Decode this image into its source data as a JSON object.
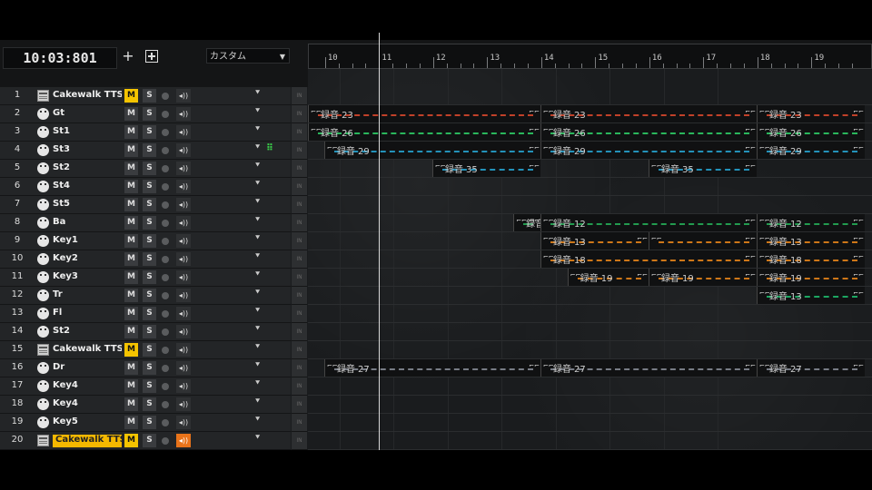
{
  "clock": "10:03:801",
  "preset": "カスタム",
  "ruler": [
    "10",
    "11",
    "12",
    "13",
    "14",
    "15",
    "16",
    "17",
    "18",
    "19"
  ],
  "buttons": {
    "mute": "M",
    "solo": "S",
    "add": "+"
  },
  "icons": {
    "add": "plus-icon",
    "add_track": "add-track-icon",
    "expand": "chevron-down-icon",
    "monitor": "speaker-icon",
    "record": "record-arm-icon"
  },
  "colors": {
    "mute_on": "#f5c400",
    "monitor_on": "#e8731a",
    "gt": "#e04a2e",
    "st1": "#2fd46a",
    "st3": "#27a9d8",
    "ba": "#27b45a",
    "key": "#f0891a",
    "tr": "#20c070",
    "dr": "#8a8f9a"
  },
  "tracks": [
    {
      "num": "1",
      "name": "Cakewalk TTS-",
      "type": "audio",
      "mute": true,
      "highlight": false,
      "monitor": false
    },
    {
      "num": "2",
      "name": "Gt",
      "type": "midi",
      "mute": false,
      "highlight": false,
      "monitor": false
    },
    {
      "num": "3",
      "name": "St1",
      "type": "midi",
      "mute": false,
      "highlight": false,
      "monitor": false
    },
    {
      "num": "4",
      "name": "St3",
      "type": "midi",
      "mute": false,
      "highlight": false,
      "monitor": false,
      "extra": "⠿"
    },
    {
      "num": "5",
      "name": "St2",
      "type": "midi",
      "mute": false,
      "highlight": false,
      "monitor": false
    },
    {
      "num": "6",
      "name": "St4",
      "type": "midi",
      "mute": false,
      "highlight": false,
      "monitor": false
    },
    {
      "num": "7",
      "name": "St5",
      "type": "midi",
      "mute": false,
      "highlight": false,
      "monitor": false
    },
    {
      "num": "8",
      "name": "Ba",
      "type": "midi",
      "mute": false,
      "highlight": false,
      "monitor": false
    },
    {
      "num": "9",
      "name": "Key1",
      "type": "midi",
      "mute": false,
      "highlight": false,
      "monitor": false
    },
    {
      "num": "10",
      "name": "Key2",
      "type": "midi",
      "mute": false,
      "highlight": false,
      "monitor": false
    },
    {
      "num": "11",
      "name": "Key3",
      "type": "midi",
      "mute": false,
      "highlight": false,
      "monitor": false
    },
    {
      "num": "12",
      "name": "Tr",
      "type": "midi",
      "mute": false,
      "highlight": false,
      "monitor": false
    },
    {
      "num": "13",
      "name": "Fl",
      "type": "midi",
      "mute": false,
      "highlight": false,
      "monitor": false
    },
    {
      "num": "14",
      "name": "St2",
      "type": "midi",
      "mute": false,
      "highlight": false,
      "monitor": false
    },
    {
      "num": "15",
      "name": "Cakewalk TTS-",
      "type": "audio",
      "mute": true,
      "highlight": false,
      "monitor": false
    },
    {
      "num": "16",
      "name": "Dr",
      "type": "midi",
      "mute": false,
      "highlight": false,
      "monitor": false
    },
    {
      "num": "17",
      "name": "Key4",
      "type": "midi",
      "mute": false,
      "highlight": false,
      "monitor": false
    },
    {
      "num": "18",
      "name": "Key4",
      "type": "midi",
      "mute": false,
      "highlight": false,
      "monitor": false
    },
    {
      "num": "19",
      "name": "Key5",
      "type": "midi",
      "mute": false,
      "highlight": false,
      "monitor": false
    },
    {
      "num": "20",
      "name": "Cakewalk TTS-",
      "type": "audio",
      "mute": true,
      "highlight": true,
      "monitor": true
    }
  ],
  "clips": [
    {
      "track": 2,
      "start": 9.6,
      "end": 14.0,
      "label": "録音 23",
      "color": "gt"
    },
    {
      "track": 2,
      "start": 14.0,
      "end": 18.0,
      "label": "録音 23",
      "color": "gt"
    },
    {
      "track": 2,
      "start": 18.0,
      "end": 20.0,
      "label": "録音 23",
      "color": "gt"
    },
    {
      "track": 3,
      "start": 9.6,
      "end": 14.0,
      "label": "録音 26",
      "color": "st1"
    },
    {
      "track": 3,
      "start": 14.0,
      "end": 18.0,
      "label": "録音 26",
      "color": "st1"
    },
    {
      "track": 3,
      "start": 18.0,
      "end": 20.0,
      "label": "録音 26",
      "color": "st1"
    },
    {
      "track": 4,
      "start": 10.0,
      "end": 14.0,
      "label": "録音 29",
      "color": "st3"
    },
    {
      "track": 4,
      "start": 14.0,
      "end": 18.0,
      "label": "録音 29",
      "color": "st3"
    },
    {
      "track": 4,
      "start": 18.0,
      "end": 20.0,
      "label": "録音 29",
      "color": "st3"
    },
    {
      "track": 5,
      "start": 12.0,
      "end": 14.0,
      "label": "録音 35",
      "color": "st3"
    },
    {
      "track": 5,
      "start": 16.0,
      "end": 18.0,
      "label": "録音 35",
      "color": "st3"
    },
    {
      "track": 8,
      "start": 13.5,
      "end": 14.0,
      "label": "録音",
      "color": "ba"
    },
    {
      "track": 8,
      "start": 14.0,
      "end": 18.0,
      "label": "録音 12",
      "color": "ba"
    },
    {
      "track": 8,
      "start": 18.0,
      "end": 20.0,
      "label": "録音 12",
      "color": "ba"
    },
    {
      "track": 9,
      "start": 14.0,
      "end": 16.0,
      "label": "録音 13",
      "color": "key"
    },
    {
      "track": 9,
      "start": 16.0,
      "end": 18.0,
      "label": "",
      "color": "key"
    },
    {
      "track": 9,
      "start": 18.0,
      "end": 20.0,
      "label": "録音 13",
      "color": "key"
    },
    {
      "track": 10,
      "start": 14.0,
      "end": 18.0,
      "label": "録音 18",
      "color": "key"
    },
    {
      "track": 10,
      "start": 18.0,
      "end": 20.0,
      "label": "録音 18",
      "color": "key"
    },
    {
      "track": 11,
      "start": 14.5,
      "end": 16.0,
      "label": "録音 19",
      "color": "key"
    },
    {
      "track": 11,
      "start": 16.0,
      "end": 18.0,
      "label": "録音 19",
      "color": "key"
    },
    {
      "track": 11,
      "start": 18.0,
      "end": 20.0,
      "label": "録音 19",
      "color": "key"
    },
    {
      "track": 12,
      "start": 18.0,
      "end": 20.0,
      "label": "録音 13",
      "color": "tr"
    },
    {
      "track": 16,
      "start": 10.0,
      "end": 14.0,
      "label": "録音 27",
      "color": "dr"
    },
    {
      "track": 16,
      "start": 14.0,
      "end": 18.0,
      "label": "録音 27",
      "color": "dr"
    },
    {
      "track": 16,
      "start": 18.0,
      "end": 20.0,
      "label": "録音 27",
      "color": "dr"
    }
  ]
}
